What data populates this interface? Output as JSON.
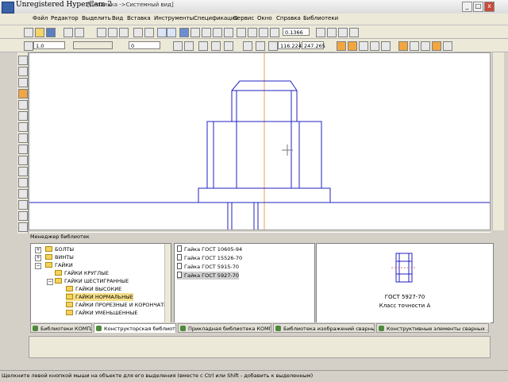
{
  "window": {
    "title": "Unregistered HyperCam 2",
    "doc_title": "[Деталька ->Системный вид]",
    "minimize": "_",
    "maximize": "□",
    "close": "x"
  },
  "menu": [
    "Файл",
    "Редактор",
    "Выделить",
    "Вид",
    "Вставка",
    "Инструменты",
    "Спецификация",
    "Сервис",
    "Окно",
    "Справка",
    "Библиотеки"
  ],
  "toolbar": {
    "zoom": "0.1366",
    "coord_x": "116.224",
    "coord_y": "247.265",
    "style_value": "1.0",
    "layer_value": "0"
  },
  "library_manager": {
    "title": "Менеджер библиотек",
    "tree": [
      {
        "label": "БОЛТЫ",
        "level": 0,
        "expander": "+"
      },
      {
        "label": "ВИНТЫ",
        "level": 0,
        "expander": "+"
      },
      {
        "label": "ГАЙКИ",
        "level": 0,
        "expander": "−"
      },
      {
        "label": "ГАЙКИ КРУГЛЫЕ",
        "level": 1,
        "expander": ""
      },
      {
        "label": "ГАЙКИ ШЕСТИГРАННЫЕ",
        "level": 1,
        "expander": "−"
      },
      {
        "label": "ГАЙКИ ВЫСОКИЕ",
        "level": 2,
        "expander": ""
      },
      {
        "label": "ГАЙКИ НОРМАЛЬНЫЕ",
        "level": 2,
        "expander": "",
        "selected": true
      },
      {
        "label": "ГАЙКИ ПРОРЕЗНЫЕ И КОРОНЧАТЫЕ",
        "level": 2,
        "expander": ""
      },
      {
        "label": "ГАЙКИ УМЕНЬШЕННЫЕ",
        "level": 2,
        "expander": ""
      }
    ],
    "models": [
      "Гайка ГОСТ 10605-94",
      "Гайка ГОСТ 15526-70",
      "Гайка ГОСТ 5915-70",
      "Гайка ГОСТ 5927-70"
    ],
    "selected_model": 3,
    "preview_title": "ГОСТ 5927-70",
    "preview_subtitle": "Класс точности А"
  },
  "tabs": [
    "Библиотеки КОМПАС",
    "Конструкторская библиотека",
    "Прикладная библиотека КОМПАС",
    "Библиотека изображений сварных ш...",
    "Конструктивные элементы сварных ..."
  ],
  "active_tab": 1,
  "status": "Щелкните левой кнопкой мыши на объекте для его выделения (вместе с Ctrl или Shift - добавить к выделенным)",
  "colors": {
    "drawing_line": "#2020c0",
    "axis_line": "#e8a050",
    "highlight": "#f7e08a"
  }
}
